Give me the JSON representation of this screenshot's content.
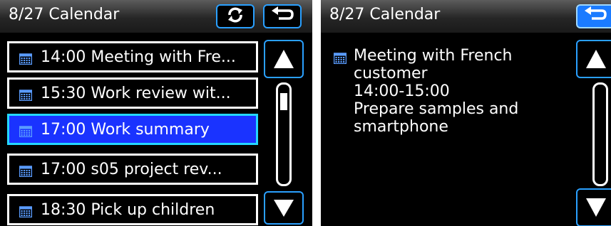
{
  "left_screen": {
    "title": "8/27 Calendar",
    "refresh_icon": "refresh-icon",
    "back_icon": "back-arrow-icon",
    "items": [
      {
        "label": "14:00 Meeting with Fre...",
        "selected": false
      },
      {
        "label": "15:30 Work review wit...",
        "selected": false
      },
      {
        "label": "17:00 Work summary",
        "selected": true
      },
      {
        "label": "17:00 s05 project rev...",
        "selected": false
      },
      {
        "label": "18:30 Pick up children",
        "selected": false
      }
    ],
    "scroll_up_icon": "triangle-up-icon",
    "scroll_down_icon": "triangle-down-icon"
  },
  "right_screen": {
    "title": "8/27 Calendar",
    "back_icon": "back-arrow-icon",
    "detail_lines": [
      "Meeting with French",
      "customer",
      "14:00-15:00",
      "Prepare samples and",
      "smartphone"
    ],
    "scroll_up_icon": "triangle-up-icon",
    "scroll_down_icon": "triangle-down-icon"
  },
  "colors": {
    "accent_border": "#2aa0ff",
    "selected_fill": "#1a33ff",
    "selected_border": "#24d7ff",
    "calendar_icon": "#5a9cff"
  }
}
